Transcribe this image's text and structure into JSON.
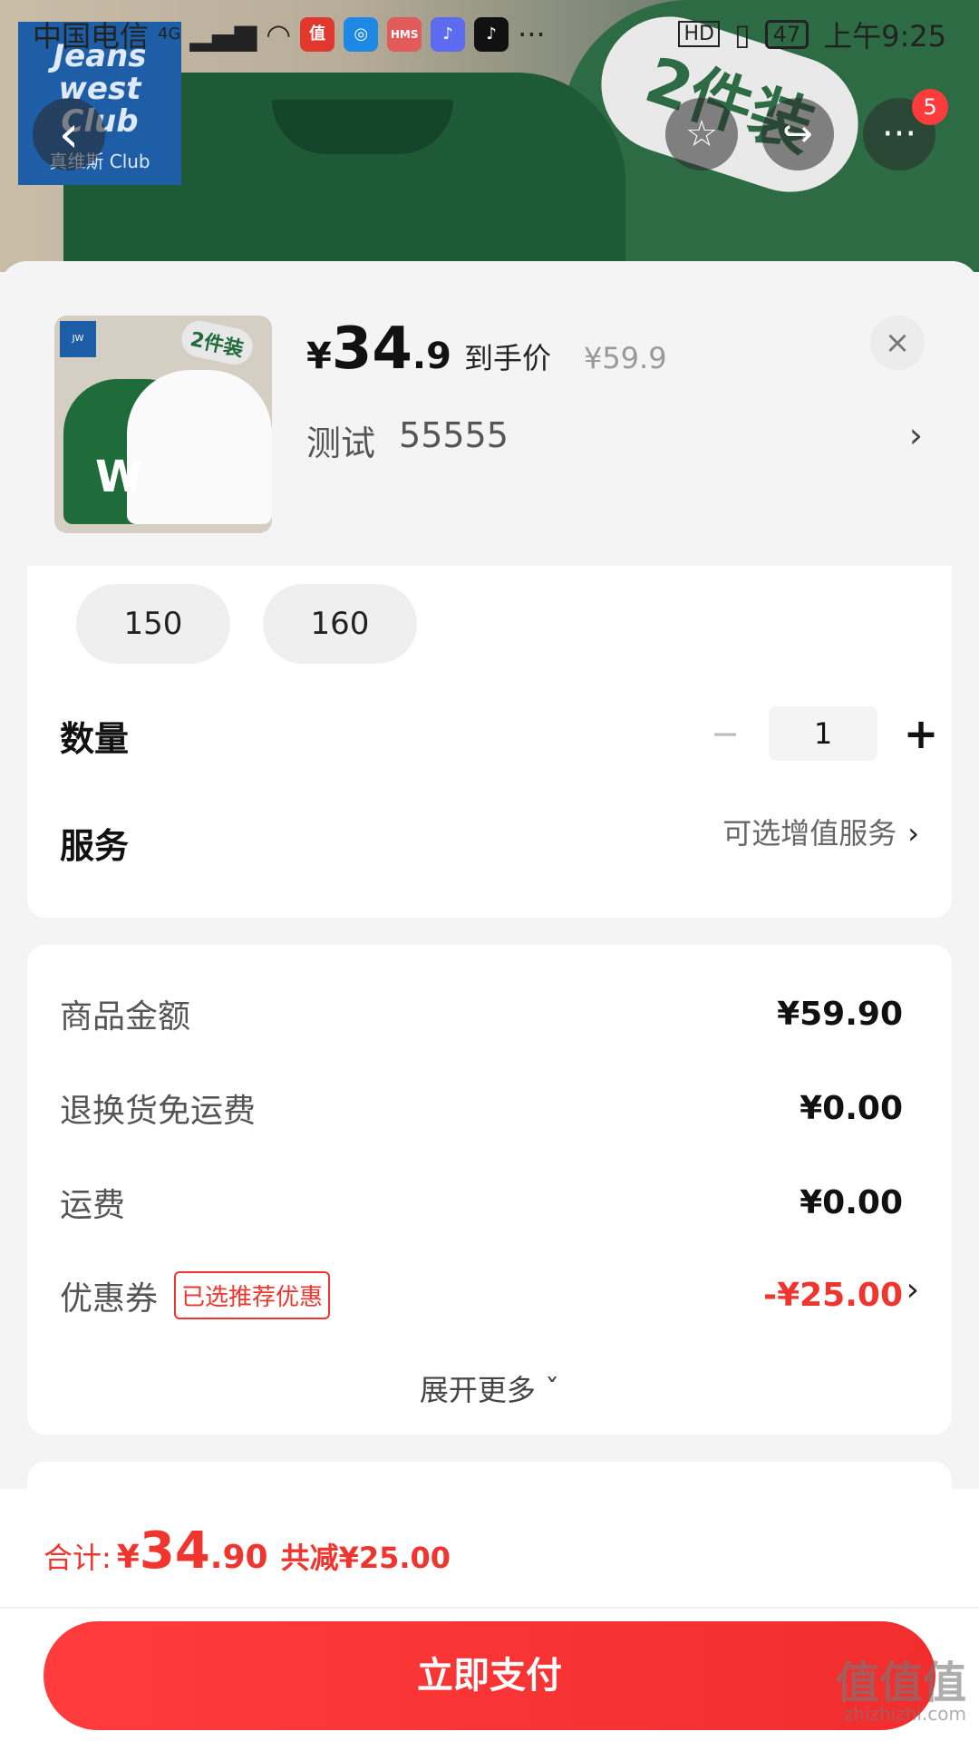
{
  "statusbar": {
    "carrier": "中国电信",
    "network": "4G",
    "battery": "47",
    "time": "上午9:25",
    "app_icons": [
      "值",
      "HMS",
      "♪",
      "♪"
    ]
  },
  "banner": {
    "brand_line1": "Jeans west Club",
    "brand_line2": "真维斯 Club",
    "pack_label": "2件装"
  },
  "nav": {
    "back_icon": "‹",
    "favorite_icon": "☆",
    "share_icon": "↪",
    "more_icon": "···",
    "more_badge": "5"
  },
  "product": {
    "thumb_label": "2件装",
    "thumb_letter": "W",
    "price_currency": "¥",
    "price_int": "34",
    "price_dec": ".9",
    "price_tag": "到手价",
    "original_price": "¥59.9",
    "variant_name": "测试",
    "variant_value": "55555",
    "close_icon": "×"
  },
  "sizes": [
    "150",
    "160"
  ],
  "quantity": {
    "label": "数量",
    "minus": "−",
    "value": "1",
    "plus": "+"
  },
  "service": {
    "label": "服务",
    "value": "可选增值服务"
  },
  "fees": {
    "goods_label": "商品金额",
    "goods_value": "¥59.90",
    "return_label": "退换货免运费",
    "return_value": "¥0.00",
    "shipping_label": "运费",
    "shipping_value": "¥0.00",
    "coupon_label": "优惠券",
    "coupon_tag": "已选推荐优惠",
    "coupon_value": "-¥25.00",
    "expand_label": "展开更多"
  },
  "total": {
    "label": "合计:",
    "currency": "¥",
    "int": "34",
    "dec": ".90",
    "saved": "共减¥25.00"
  },
  "pay_button": "立即支付",
  "watermark": {
    "main": "值值值",
    "sub": "zhizhizhi.com"
  },
  "colors": {
    "accent_red": "#f0352e",
    "brand_green": "#1f6b3a",
    "brand_blue": "#1d5ea6"
  }
}
